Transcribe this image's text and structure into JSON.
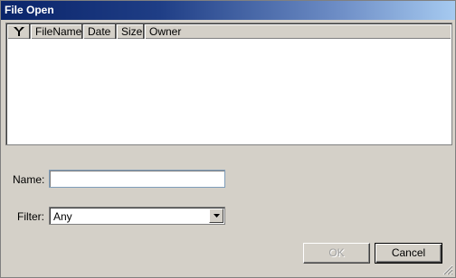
{
  "window": {
    "title": "File Open"
  },
  "file_list": {
    "columns": [
      "FileName",
      "Date",
      "Size",
      "Owner"
    ],
    "rows": []
  },
  "form": {
    "name_label": "Name:",
    "name_value": "",
    "filter_label": "Filter:",
    "filter_value": "Any"
  },
  "buttons": {
    "ok": "OK",
    "cancel": "Cancel"
  },
  "icons": {
    "filter_column": "filter-funnel-icon",
    "dropdown": "chevron-down-icon",
    "resize": "resize-grip-icon"
  },
  "colors": {
    "title_gradient_start": "#0a246a",
    "title_gradient_end": "#a6caf0",
    "dialog_bg": "#d4d0c8"
  }
}
